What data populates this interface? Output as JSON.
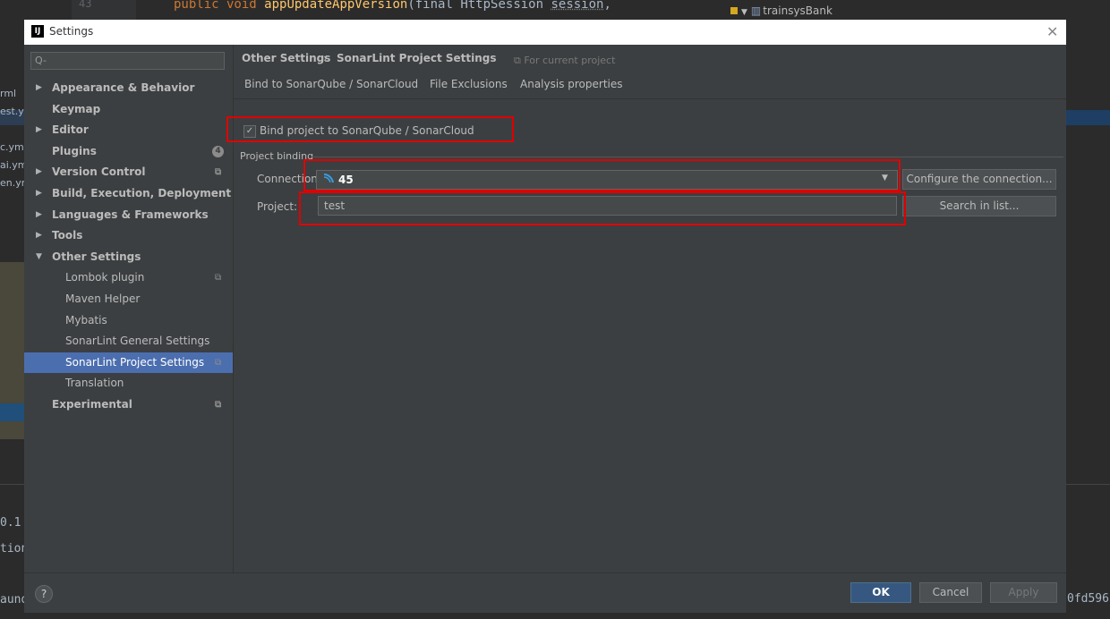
{
  "background": {
    "line_number": "43",
    "code": {
      "kw": "public void ",
      "fn": "appUpdateAppVersion",
      "mid": "(final HttpSession ",
      "param": "session",
      "end": ","
    },
    "tree_item": "trainsysBank",
    "left_fragments": [
      "rml",
      "est.yn",
      "c.yml",
      "ai.ym",
      "en.yn"
    ],
    "bottom_fragments": [
      "0.1",
      "tion",
      "aund"
    ],
    "right_fragment": "0fd596"
  },
  "dialog": {
    "title": "Settings",
    "app_icon_text": "IJ",
    "search_placeholder": "Q-",
    "nav": [
      {
        "label": "Appearance & Behavior",
        "arrow": "▶",
        "bold": true,
        "indent": 0
      },
      {
        "label": "Keymap",
        "arrow": "",
        "bold": true,
        "indent": 0
      },
      {
        "label": "Editor",
        "arrow": "▶",
        "bold": true,
        "indent": 0
      },
      {
        "label": "Plugins",
        "arrow": "",
        "bold": true,
        "indent": 0,
        "badge": "4"
      },
      {
        "label": "Version Control",
        "arrow": "▶",
        "bold": true,
        "indent": 0,
        "proj": true
      },
      {
        "label": "Build, Execution, Deployment",
        "arrow": "▶",
        "bold": true,
        "indent": 0
      },
      {
        "label": "Languages & Frameworks",
        "arrow": "▶",
        "bold": true,
        "indent": 0
      },
      {
        "label": "Tools",
        "arrow": "▶",
        "bold": true,
        "indent": 0
      },
      {
        "label": "Other Settings",
        "arrow": "▼",
        "bold": true,
        "indent": 0
      },
      {
        "label": "Lombok plugin",
        "arrow": "",
        "bold": false,
        "indent": 1,
        "proj": true
      },
      {
        "label": "Maven Helper",
        "arrow": "",
        "bold": false,
        "indent": 1
      },
      {
        "label": "Mybatis",
        "arrow": "",
        "bold": false,
        "indent": 1
      },
      {
        "label": "SonarLint General Settings",
        "arrow": "",
        "bold": false,
        "indent": 1
      },
      {
        "label": "SonarLint Project Settings",
        "arrow": "",
        "bold": false,
        "indent": 1,
        "proj": true,
        "selected": true
      },
      {
        "label": "Translation",
        "arrow": "",
        "bold": false,
        "indent": 1
      },
      {
        "label": "Experimental",
        "arrow": "",
        "bold": true,
        "indent": 0,
        "proj": true
      }
    ],
    "breadcrumb": {
      "parent": "Other Settings",
      "sep": "›",
      "current": "SonarLint Project Settings",
      "scope": "For current project"
    },
    "tabs": [
      "Bind to SonarQube / SonarCloud",
      "File Exclusions",
      "Analysis properties"
    ],
    "bind_checkbox": {
      "label": "Bind project to SonarQube / SonarCloud",
      "checked": true
    },
    "project_binding": {
      "section_title": "Project binding",
      "connection_label": "Connection:",
      "connection_value": "45",
      "configure_button": "Configure the connection...",
      "project_label": "Project:",
      "project_value": "test",
      "search_button": "Search in list..."
    },
    "footer": {
      "help": "?",
      "ok": "OK",
      "cancel": "Cancel",
      "apply": "Apply"
    }
  },
  "colors": {
    "selection": "#4b6eaf",
    "highlight": "#e00000",
    "ok_button": "#365880"
  }
}
